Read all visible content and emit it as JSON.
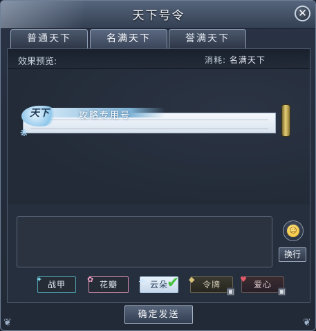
{
  "window": {
    "title": "天下号令"
  },
  "tabs": [
    {
      "label": "普通天下",
      "active": false
    },
    {
      "label": "名满天下",
      "active": true
    },
    {
      "label": "誉满天下",
      "active": false
    }
  ],
  "preview": {
    "label": "效果预览:",
    "cost_label": "消耗:",
    "cost_value": "名满天下",
    "banner_tag": "天下",
    "banner_text": "攻略专用号"
  },
  "message": {
    "value": "",
    "placeholder": ""
  },
  "buttons": {
    "newline": "换行",
    "send": "确定发送"
  },
  "styles": [
    {
      "label": "战甲",
      "selected": false,
      "locked": false,
      "color": "#4fa7b7"
    },
    {
      "label": "花瓣",
      "selected": false,
      "locked": false,
      "color": "#d28bb0"
    },
    {
      "label": "云朵",
      "selected": true,
      "locked": false,
      "color": "#a9c7e2"
    },
    {
      "label": "令牌",
      "selected": false,
      "locked": true,
      "color": "#6b6656"
    },
    {
      "label": "爱心",
      "selected": false,
      "locked": true,
      "color": "#6e5b5b"
    }
  ],
  "icons": {
    "close": "close-icon",
    "emoji": "smiley-icon",
    "check": "checkmark-icon",
    "lock": "lock-icon"
  }
}
